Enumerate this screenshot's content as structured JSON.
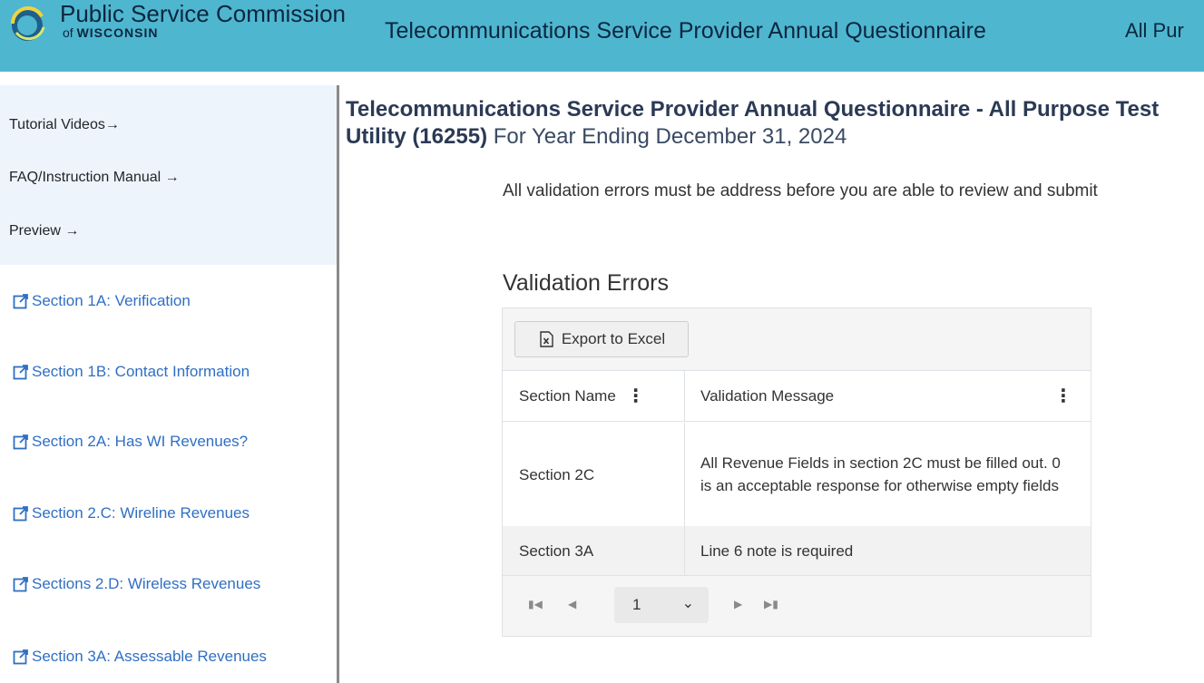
{
  "header": {
    "org_name_line1": "Public Service Commission",
    "org_name_line2_prefix": "of",
    "org_name_line2_state": "WISCONSIN",
    "app_title": "Telecommunications Service Provider Annual Questionnaire",
    "truncated_subtitle": "All Pur"
  },
  "sidebar": {
    "top_links": [
      {
        "label": "Tutorial Videos→"
      },
      {
        "label": "FAQ/Instruction Manual →"
      },
      {
        "label": "Preview →"
      }
    ],
    "items": [
      {
        "label": "Section 1A: Verification",
        "icon": "external-link-icon"
      },
      {
        "label": "Section 1B: Contact Information",
        "icon": "external-link-icon"
      },
      {
        "label": "Section 2A: Has WI Revenues?",
        "icon": "external-link-icon"
      },
      {
        "label": "Section 2.C: Wireline Revenues",
        "icon": "external-link-icon"
      },
      {
        "label": "Sections 2.D: Wireless Revenues",
        "icon": "external-link-icon"
      },
      {
        "label": "Section 3A: Assessable Revenues",
        "icon": "external-link-icon"
      }
    ]
  },
  "main": {
    "title_bold": "Telecommunications Service Provider Annual Questionnaire - All Purpose Test Utility (16255)",
    "title_year": "For Year Ending December 31, 2024",
    "notice": "All validation errors must be address before you are able to review and submit",
    "section_heading": "Validation Errors",
    "grid": {
      "export_label": "Export to Excel",
      "columns": [
        "Section Name",
        "Validation Message"
      ],
      "rows": [
        {
          "section": "Section 2C",
          "message": "All Revenue Fields in section 2C must be filled out. 0 is an acceptable response for otherwise empty fields"
        },
        {
          "section": "Section 3A",
          "message": "Line 6 note is required"
        }
      ],
      "pager": {
        "current_page": "1"
      }
    }
  },
  "colors": {
    "header_bg": "#4fb6cf",
    "sidebar_top_bg": "#eef4fc",
    "link_blue": "#2f6fc4",
    "title_navy": "#2b3a55"
  }
}
